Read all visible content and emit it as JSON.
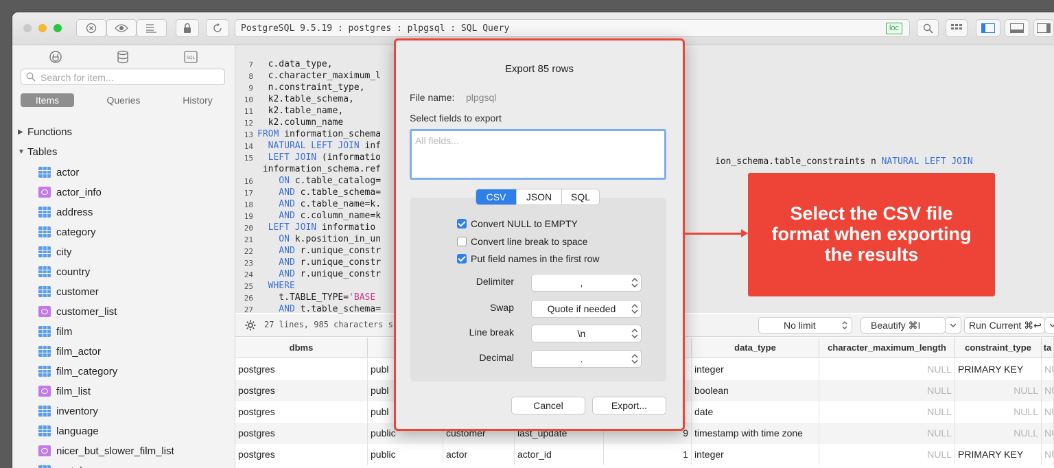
{
  "window": {
    "title": "PostgreSQL 9.5.19 : postgres : plpgsql : SQL Query",
    "loc_badge": "loc"
  },
  "sidebar": {
    "search_placeholder": "Search for item...",
    "segments": [
      "Items",
      "Queries",
      "History"
    ],
    "groups": [
      {
        "label": "Functions",
        "expanded": false
      },
      {
        "label": "Tables",
        "expanded": true
      }
    ],
    "tables": [
      {
        "name": "actor",
        "kind": "table"
      },
      {
        "name": "actor_info",
        "kind": "view"
      },
      {
        "name": "address",
        "kind": "table"
      },
      {
        "name": "category",
        "kind": "table"
      },
      {
        "name": "city",
        "kind": "table"
      },
      {
        "name": "country",
        "kind": "table"
      },
      {
        "name": "customer",
        "kind": "table"
      },
      {
        "name": "customer_list",
        "kind": "view"
      },
      {
        "name": "film",
        "kind": "table"
      },
      {
        "name": "film_actor",
        "kind": "table"
      },
      {
        "name": "film_category",
        "kind": "table"
      },
      {
        "name": "film_list",
        "kind": "view"
      },
      {
        "name": "inventory",
        "kind": "table"
      },
      {
        "name": "language",
        "kind": "table"
      },
      {
        "name": "nicer_but_slower_film_list",
        "kind": "view"
      },
      {
        "name": "rental",
        "kind": "table"
      }
    ]
  },
  "editor": {
    "lines": [
      {
        "n": "7",
        "text": "  c.data_type,"
      },
      {
        "n": "8",
        "text": "  c.character_maximum_l"
      },
      {
        "n": "9",
        "text": "  n.constraint_type,"
      },
      {
        "n": "10",
        "text": "  k2.table_schema,"
      },
      {
        "n": "11",
        "text": "  k2.table_name,"
      },
      {
        "n": "12",
        "text": "  k2.column_name"
      },
      {
        "n": "13",
        "kw": "FROM",
        "text": " information_schema"
      },
      {
        "n": "14",
        "kw": "  NATURAL LEFT JOIN",
        "text": " inf"
      },
      {
        "n": "15",
        "kw": "  LEFT JOIN",
        "text": " (informatio"
      },
      {
        "n": "",
        "text": " information_schema.ref"
      },
      {
        "n": "16",
        "kw": "    ON",
        "text": " c.table_catalog="
      },
      {
        "n": "17",
        "kw": "    AND",
        "text": " c.table_schema="
      },
      {
        "n": "18",
        "kw": "    AND",
        "text": " c.table_name=k."
      },
      {
        "n": "19",
        "kw": "    AND",
        "text": " c.column_name=k"
      },
      {
        "n": "20",
        "kw": "  LEFT JOIN",
        "text": " informatio"
      },
      {
        "n": "21",
        "kw": "    ON",
        "text": " k.position_in_un"
      },
      {
        "n": "22",
        "kw": "    AND",
        "text": " r.unique_constr"
      },
      {
        "n": "23",
        "kw": "    AND",
        "text": " r.unique_constr"
      },
      {
        "n": "24",
        "kw": "    AND",
        "text": " r.unique_constr"
      },
      {
        "n": "25",
        "kw": "  WHERE",
        "text": ""
      },
      {
        "n": "26",
        "text": "    t.TABLE_TYPE=",
        "str": "'BASE"
      },
      {
        "n": "27",
        "kw": "    AND",
        "text": " t.table_schema="
      }
    ],
    "line15_right_text": "ion_schema.table_constraints n",
    "line15_right_kw": " NATURAL LEFT JOIN",
    "status": "27 lines, 985 characters s",
    "limit_label": "No limit",
    "beautify_label": "Beautify ⌘I",
    "run_label": "Run Current ⌘↩"
  },
  "grid": {
    "headers": [
      "dbms",
      "tabl",
      "",
      "",
      "",
      "data_type",
      "character_maximum_length",
      "constraint_type",
      "ta"
    ],
    "rows": [
      [
        "postgres",
        "publ",
        "",
        "",
        "",
        "integer",
        "NULL",
        "PRIMARY KEY",
        "NU"
      ],
      [
        "postgres",
        "publ",
        "",
        "",
        "",
        "boolean",
        "NULL",
        "NULL",
        "NU"
      ],
      [
        "postgres",
        "publ",
        "",
        "",
        "",
        "date",
        "NULL",
        "NULL",
        "NU"
      ],
      [
        "postgres",
        "public",
        "customer",
        "last_update",
        "9",
        "timestamp with time zone",
        "NULL",
        "NULL",
        "NU"
      ],
      [
        "postgres",
        "public",
        "actor",
        "actor_id",
        "1",
        "integer",
        "NULL",
        "PRIMARY KEY",
        "NU"
      ]
    ]
  },
  "export_dialog": {
    "title": "Export 85 rows",
    "file_name_label": "File name:",
    "file_name_value": "plpgsql",
    "select_fields_label": "Select fields to export",
    "fields_placeholder": "All fields...",
    "formats": [
      "CSV",
      "JSON",
      "SQL"
    ],
    "active_format": "CSV",
    "options": [
      {
        "label": "Convert NULL to EMPTY",
        "checked": true
      },
      {
        "label": "Convert line break to space",
        "checked": false
      },
      {
        "label": "Put field names in the first row",
        "checked": true
      }
    ],
    "settings": [
      {
        "label": "Delimiter",
        "value": ","
      },
      {
        "label": "Swap",
        "value": "Quote if needed"
      },
      {
        "label": "Line break",
        "value": "\\n"
      },
      {
        "label": "Decimal",
        "value": "."
      }
    ],
    "cancel_label": "Cancel",
    "export_label": "Export..."
  },
  "callout": {
    "lines": [
      "Select the CSV file",
      "format when exporting",
      "the results"
    ],
    "color": "#ee4437"
  },
  "colors": {
    "accent": "#2f7fe8",
    "annotation": "#ee4437",
    "keyword": "#3a6fd8"
  }
}
